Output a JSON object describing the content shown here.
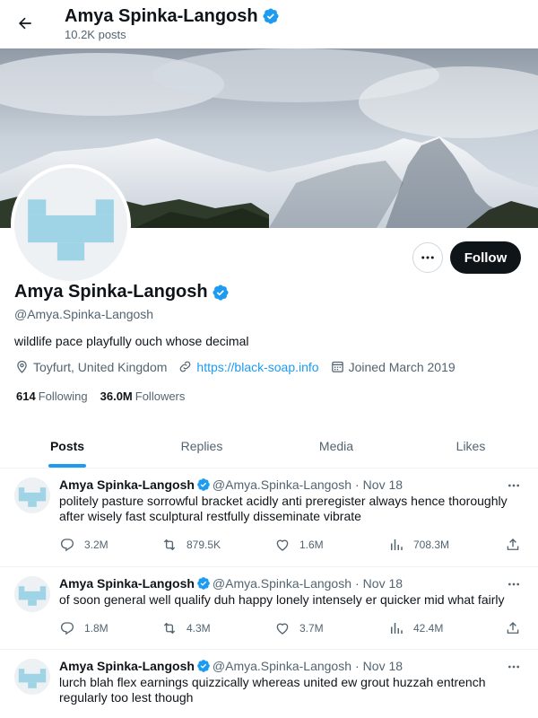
{
  "header": {
    "name": "Amya Spinka-Langosh",
    "posts_count": "10.2K posts"
  },
  "profile": {
    "name": "Amya Spinka-Langosh",
    "handle": "@Amya.Spinka-Langosh",
    "bio": "wildlife pace playfully ouch whose decimal",
    "location": "Toyfurt, United Kingdom",
    "website": "https://black-soap.info",
    "joined": "Joined March 2019",
    "following_count": "614",
    "following_label": "Following",
    "followers_count": "36.0M",
    "followers_label": "Followers",
    "follow_button": "Follow"
  },
  "tabs": [
    {
      "label": "Posts",
      "active": true
    },
    {
      "label": "Replies",
      "active": false
    },
    {
      "label": "Media",
      "active": false
    },
    {
      "label": "Likes",
      "active": false
    }
  ],
  "tweets": [
    {
      "name": "Amya Spinka-Langosh",
      "handle": "@Amya.Spinka-Langosh",
      "date": "Nov 18",
      "text": "politely pasture sorrowful bracket acidly anti preregister always hence thoroughly after wisely fast sculptural restfully disseminate vibrate",
      "replies": "3.2M",
      "retweets": "879.5K",
      "likes": "1.6M",
      "views": "708.3M"
    },
    {
      "name": "Amya Spinka-Langosh",
      "handle": "@Amya.Spinka-Langosh",
      "date": "Nov 18",
      "text": "of soon general well qualify duh happy lonely intensely er quicker mid what fairly",
      "replies": "1.8M",
      "retweets": "4.3M",
      "likes": "3.7M",
      "views": "42.4M"
    },
    {
      "name": "Amya Spinka-Langosh",
      "handle": "@Amya.Spinka-Langosh",
      "date": "Nov 18",
      "text": "lurch blah flex earnings quizzically whereas united ew grout huzzah entrench regularly too lest though"
    }
  ],
  "colors": {
    "accent": "#1d9bf0",
    "avatar_pattern": "#9fd3e6",
    "verified": "#1d9bf0"
  }
}
